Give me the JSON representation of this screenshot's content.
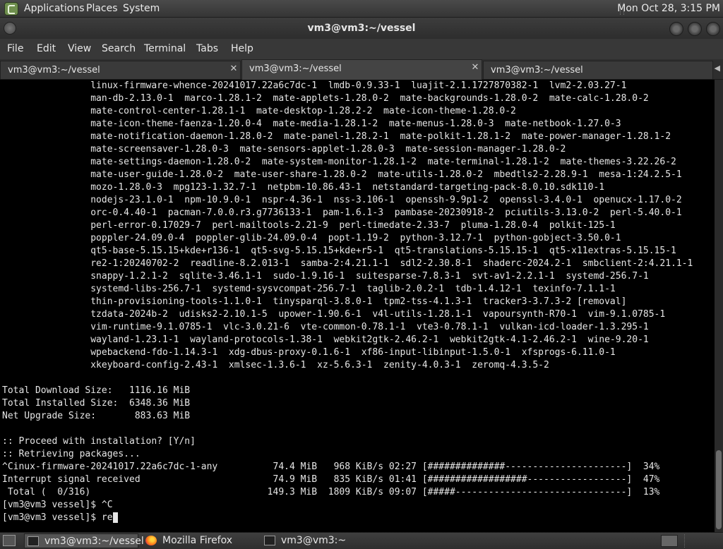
{
  "top_panel": {
    "menus": [
      "Applications",
      "Places",
      "System"
    ],
    "clock": "Mon Oct 28,  3:15 PM"
  },
  "window": {
    "title": "vm3@vm3:~/vessel"
  },
  "menubar": {
    "items": [
      "File",
      "Edit",
      "View",
      "Search",
      "Terminal",
      "Tabs",
      "Help"
    ]
  },
  "tabs": [
    {
      "label": "vm3@vm3:~/vessel",
      "active": false
    },
    {
      "label": "vm3@vm3:~/vessel",
      "active": true
    },
    {
      "label": "vm3@vm3:~/vessel",
      "active": false
    }
  ],
  "terminal": {
    "lines": [
      "                linux-firmware-whence-20241017.22a6c7dc-1  lmdb-0.9.33-1  luajit-2.1.1727870382-1  lvm2-2.03.27-1",
      "                man-db-2.13.0-1  marco-1.28.1-2  mate-applets-1.28.0-2  mate-backgrounds-1.28.0-2  mate-calc-1.28.0-2",
      "                mate-control-center-1.28.1-1  mate-desktop-1.28.2-2  mate-icon-theme-1.28.0-2",
      "                mate-icon-theme-faenza-1.20.0-4  mate-media-1.28.1-2  mate-menus-1.28.0-3  mate-netbook-1.27.0-3",
      "                mate-notification-daemon-1.28.0-2  mate-panel-1.28.2-1  mate-polkit-1.28.1-2  mate-power-manager-1.28.1-2",
      "                mate-screensaver-1.28.0-3  mate-sensors-applet-1.28.0-3  mate-session-manager-1.28.0-2",
      "                mate-settings-daemon-1.28.0-2  mate-system-monitor-1.28.1-2  mate-terminal-1.28.1-2  mate-themes-3.22.26-2",
      "                mate-user-guide-1.28.0-2  mate-user-share-1.28.0-2  mate-utils-1.28.0-2  mbedtls2-2.28.9-1  mesa-1:24.2.5-1",
      "                mozo-1.28.0-3  mpg123-1.32.7-1  netpbm-10.86.43-1  netstandard-targeting-pack-8.0.10.sdk110-1",
      "                nodejs-23.1.0-1  npm-10.9.0-1  nspr-4.36-1  nss-3.106-1  openssh-9.9p1-2  openssl-3.4.0-1  openucx-1.17.0-2",
      "                orc-0.4.40-1  pacman-7.0.0.r3.g7736133-1  pam-1.6.1-3  pambase-20230918-2  pciutils-3.13.0-2  perl-5.40.0-1",
      "                perl-error-0.17029-7  perl-mailtools-2.21-9  perl-timedate-2.33-7  pluma-1.28.0-4  polkit-125-1",
      "                poppler-24.09.0-4  poppler-glib-24.09.0-4  popt-1.19-2  python-3.12.7-1  python-gobject-3.50.0-1",
      "                qt5-base-5.15.15+kde+r136-1  qt5-svg-5.15.15+kde+r5-1  qt5-translations-5.15.15-1  qt5-x11extras-5.15.15-1",
      "                re2-1:20240702-2  readline-8.2.013-1  samba-2:4.21.1-1  sdl2-2.30.8-1  shaderc-2024.2-1  smbclient-2:4.21.1-1",
      "                snappy-1.2.1-2  sqlite-3.46.1-1  sudo-1.9.16-1  suitesparse-7.8.3-1  svt-av1-2.2.1-1  systemd-256.7-1",
      "                systemd-libs-256.7-1  systemd-sysvcompat-256.7-1  taglib-2.0.2-1  tdb-1.4.12-1  texinfo-7.1.1-1",
      "                thin-provisioning-tools-1.1.0-1  tinysparql-3.8.0-1  tpm2-tss-4.1.3-1  tracker3-3.7.3-2 [removal]",
      "                tzdata-2024b-2  udisks2-2.10.1-5  upower-1.90.6-1  v4l-utils-1.28.1-1  vapoursynth-R70-1  vim-9.1.0785-1",
      "                vim-runtime-9.1.0785-1  vlc-3.0.21-6  vte-common-0.78.1-1  vte3-0.78.1-1  vulkan-icd-loader-1.3.295-1",
      "                wayland-1.23.1-1  wayland-protocols-1.38-1  webkit2gtk-2.46.2-1  webkit2gtk-4.1-2.46.2-1  wine-9.20-1",
      "                wpebackend-fdo-1.14.3-1  xdg-dbus-proxy-0.1.6-1  xf86-input-libinput-1.5.0-1  xfsprogs-6.11.0-1",
      "                xkeyboard-config-2.43-1  xmlsec-1.3.6-1  xz-5.6.3-1  zenity-4.0.3-1  zeromq-4.3.5-2",
      "",
      "Total Download Size:   1116.16 MiB",
      "Total Installed Size:  6348.36 MiB",
      "Net Upgrade Size:       883.63 MiB",
      "",
      ":: Proceed with installation? [Y/n]",
      ":: Retrieving packages...",
      "^Cinux-firmware-20241017.22a6c7dc-1-any          74.4 MiB   968 KiB/s 02:27 [##############----------------------]  34%",
      "Interrupt signal received                        74.9 MiB   835 KiB/s 01:41 [##################------------------]  47%",
      " Total (  0/316)                                149.3 MiB  1809 KiB/s 09:07 [#####-------------------------------]  13%",
      "[vm3@vm3 vessel]$ ^C"
    ],
    "prompt": "[vm3@vm3 vessel]$ ",
    "input": "re"
  },
  "taskbar": {
    "tasks": [
      {
        "label": "vm3@vm3:~/vessel",
        "icon": "terminal-icon",
        "active": true
      },
      {
        "label": "Mozilla Firefox",
        "icon": "firefox-icon",
        "active": false
      },
      {
        "label": "vm3@vm3:~",
        "icon": "terminal-icon",
        "active": false
      }
    ]
  }
}
